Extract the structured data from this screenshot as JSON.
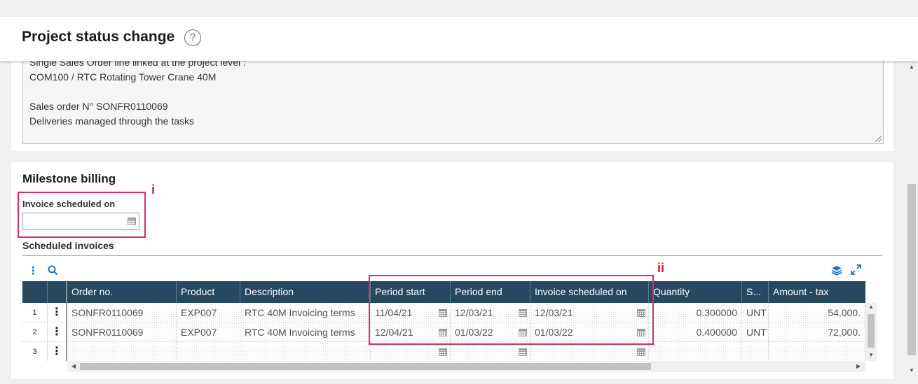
{
  "header": {
    "title": "Project status change",
    "help_icon": "?"
  },
  "notes": {
    "lines": [
      "Single Sales Order line linked at the project level :",
      "COM100 / RTC Rotating Tower Crane 40M",
      "",
      "Sales order N° SONFR0110069",
      "Deliveries managed through the tasks"
    ]
  },
  "milestone": {
    "title": "Milestone billing",
    "field_label": "Invoice scheduled on",
    "field_value": "",
    "marker_i": "i",
    "marker_ii": "ii",
    "subsection": "Scheduled invoices"
  },
  "grid": {
    "columns": [
      "Order no.",
      "Product",
      "Description",
      "Period start",
      "Period end",
      "Invoice scheduled on",
      "Quantity",
      "S...",
      "Amount - tax"
    ],
    "rows": [
      {
        "idx": "1",
        "order": "SONFR0110069",
        "product": "EXP007",
        "description": "RTC 40M Invoicing terms",
        "period_start": "11/04/21",
        "period_end": "12/03/21",
        "invoice_on": "12/03/21",
        "quantity": "0.300000",
        "unit": "UNT",
        "amount": "54,000."
      },
      {
        "idx": "2",
        "order": "SONFR0110069",
        "product": "EXP007",
        "description": "RTC 40M Invoicing terms",
        "period_start": "12/04/21",
        "period_end": "01/03/22",
        "invoice_on": "01/03/22",
        "quantity": "0.400000",
        "unit": "UNT",
        "amount": "72,000."
      },
      {
        "idx": "3",
        "order": "",
        "product": "",
        "description": "",
        "period_start": "",
        "period_end": "",
        "invoice_on": "",
        "quantity": "",
        "unit": "",
        "amount": ""
      }
    ]
  },
  "colors": {
    "header_bg": "#27495f",
    "highlight": "#d4306a",
    "marker": "#e0192e",
    "accent": "#1a76b9"
  }
}
